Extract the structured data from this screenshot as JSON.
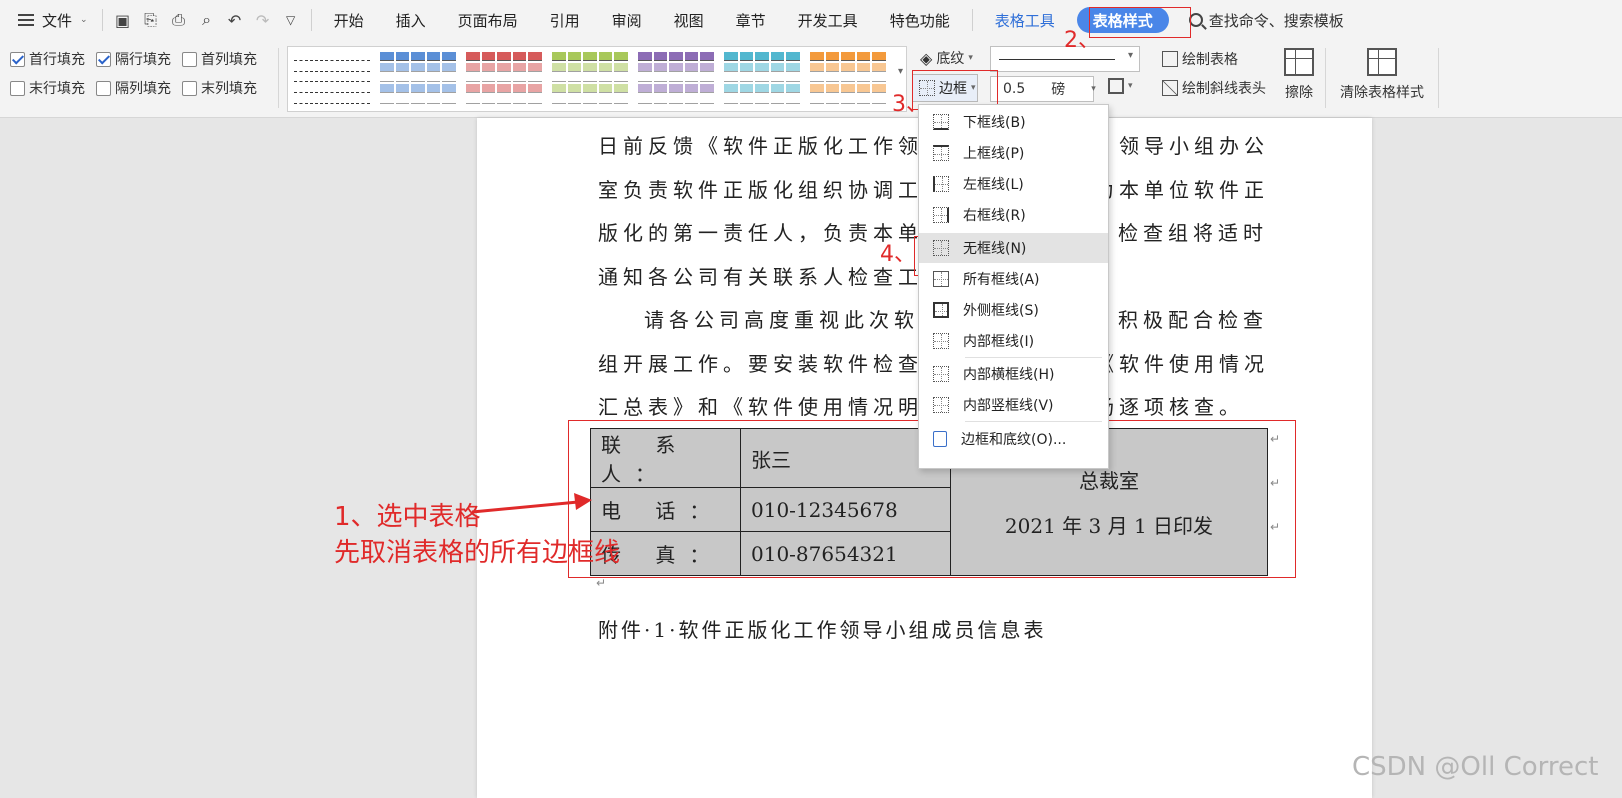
{
  "menubar": {
    "file_label": "文件",
    "tabs": [
      "开始",
      "插入",
      "页面布局",
      "引用",
      "审阅",
      "视图",
      "章节",
      "开发工具",
      "特色功能"
    ],
    "tool_tab": "表格工具",
    "active_tab": "表格样式",
    "search_label": "查找命令、搜索模板"
  },
  "ribbon": {
    "checkboxes": {
      "first_row": "首行填充",
      "banded_rows": "隔行填充",
      "first_col": "首列填充",
      "last_row": "末行填充",
      "banded_cols": "隔列填充",
      "last_col": "末列填充"
    },
    "shading_label": "底纹",
    "border_label": "边框",
    "line_weight_value": "0.5",
    "line_weight_unit": "磅",
    "draw_table_label": "绘制表格",
    "draw_diagonal_label": "绘制斜线表头",
    "erase_label": "擦除",
    "clear_style_label": "清除表格样式",
    "style_colors": [
      "#ffffff",
      "#5b8fd6",
      "#d65b5b",
      "#a8c85a",
      "#8c6cb5",
      "#52b7cf",
      "#f39a3c"
    ]
  },
  "document": {
    "lines": [
      "日前反馈《软件正版化工作领导",
      "、领导小组办公",
      "室负责软件正版化组织协调工作",
      "为本单位软件正",
      "版化的第一责任人，负责本单位",
      "检查组将适时",
      "通知各公司有关联系人检查工作",
      "请各公司高度重视此次软件",
      "积极配合检查",
      "组开展工作。要安装软件检查工",
      "《软件使用情况",
      "汇总表》和《软件使用情况明细",
      "场逐项核查。"
    ],
    "return_mark": "↵",
    "attachment": "附件·1·软件正版化工作领导小组成员信息表"
  },
  "table": {
    "rows": [
      {
        "label": "联 系 人：",
        "value": "张三"
      },
      {
        "label": "电  话：",
        "value": "010-12345678"
      },
      {
        "label": "传  真：",
        "value": "010-87654321"
      }
    ],
    "merged_line1": "总裁室",
    "merged_line2": "2021 年 3 月 1 日印发"
  },
  "border_menu": {
    "items": [
      "下框线(B)",
      "上框线(P)",
      "左框线(L)",
      "右框线(R)",
      "无框线(N)",
      "所有框线(A)",
      "外侧框线(S)",
      "内部框线(I)",
      "内部横框线(H)",
      "内部竖框线(V)",
      "边框和底纹(O)..."
    ],
    "highlighted_index": 4
  },
  "annotations": {
    "step1_line1": "1、选中表格",
    "step1_line2": "先取消表格的所有边框线",
    "step2": "2、",
    "step3": "3、",
    "step4": "4、",
    "color": "#e02a2a"
  },
  "watermark": "CSDN @Oll Correct"
}
